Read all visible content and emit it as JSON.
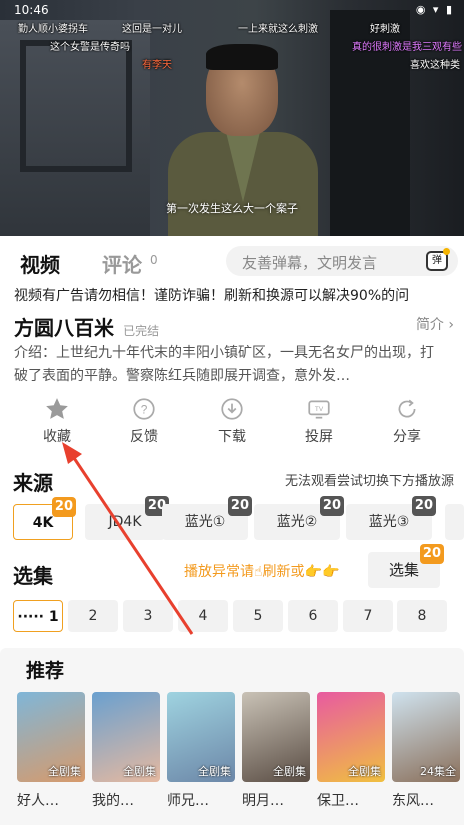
{
  "status_bar": {
    "time": "10:46",
    "system_icons": "◉ ▾ ▮"
  },
  "player": {
    "danmaku": [
      {
        "text": "勤人顺小婆拐车",
        "color": "#ffffff"
      },
      {
        "text": "这回是一对儿",
        "color": "#ffffff"
      },
      {
        "text": "一上来就这么刺激",
        "color": "#ffffff"
      },
      {
        "text": "好刺激",
        "color": "#ffffff"
      },
      {
        "text": "这个女警是传奇吗",
        "color": "#ffffff"
      },
      {
        "text": "真的很刺激是我三观有些",
        "color": "#e07bff"
      },
      {
        "text": "有李天",
        "color": "#ff6a3d"
      },
      {
        "text": "喜欢这种类",
        "color": "#ffffff"
      }
    ],
    "subtitle": "第一次发生这么大一个案子"
  },
  "tabs": {
    "video": "视频",
    "comment": "评论",
    "comment_count": "0",
    "danmu_placeholder": "友善弹幕，文明发言",
    "danmu_button": "弹"
  },
  "notice": "视频有广告请勿相信！谨防诈骗！刷新和换源可以解决90%的问",
  "show": {
    "title": "方圆八百米",
    "status": "已完结",
    "intro_link": "简介 ›",
    "description": "介绍：上世纪九十年代末的丰阳小镇矿区，一具无名女尸的出现，打破了表面的平静。警察陈红兵随即展开调查，意外发…"
  },
  "actions": [
    {
      "label": "收藏",
      "icon": "star-icon"
    },
    {
      "label": "反馈",
      "icon": "feedback-icon"
    },
    {
      "label": "下载",
      "icon": "download-icon"
    },
    {
      "label": "投屏",
      "icon": "cast-icon"
    },
    {
      "label": "分享",
      "icon": "share-icon"
    }
  ],
  "source": {
    "title": "来源",
    "tip": "无法观看尝试切换下方播放源",
    "items": [
      {
        "label": "4K",
        "badge": "20",
        "active": true
      },
      {
        "label": "JD4K",
        "badge": "20",
        "active": false
      },
      {
        "label": "蓝光①",
        "badge": "20",
        "active": false
      },
      {
        "label": "蓝光②",
        "badge": "20",
        "active": false
      },
      {
        "label": "蓝光③",
        "badge": "20",
        "active": false
      }
    ]
  },
  "episodes": {
    "title": "选集",
    "tip": "播放异常请☝刷新或👉👉",
    "select_button": "选集",
    "select_badge": "20",
    "items": [
      "····· 1",
      "2",
      "3",
      "4",
      "5",
      "6",
      "7",
      "8"
    ]
  },
  "recommend": {
    "title": "推荐",
    "items": [
      {
        "name": "好人…",
        "tag": "全剧集",
        "colors": [
          "#7fb6d8",
          "#d79a6b"
        ]
      },
      {
        "name": "我的…",
        "tag": "全剧集",
        "colors": [
          "#6aa0cf",
          "#e6b9a0"
        ]
      },
      {
        "name": "师兄…",
        "tag": "全剧集",
        "colors": [
          "#9fd3e0",
          "#6c87a8"
        ]
      },
      {
        "name": "明月…",
        "tag": "全剧集",
        "colors": [
          "#c9c2b6",
          "#5a4d44"
        ]
      },
      {
        "name": "保卫…",
        "tag": "全剧集",
        "colors": [
          "#e85aa0",
          "#f0c040"
        ]
      },
      {
        "name": "东风…",
        "tag": "24集全",
        "colors": [
          "#cfe2ee",
          "#8a6f5a"
        ]
      }
    ]
  }
}
